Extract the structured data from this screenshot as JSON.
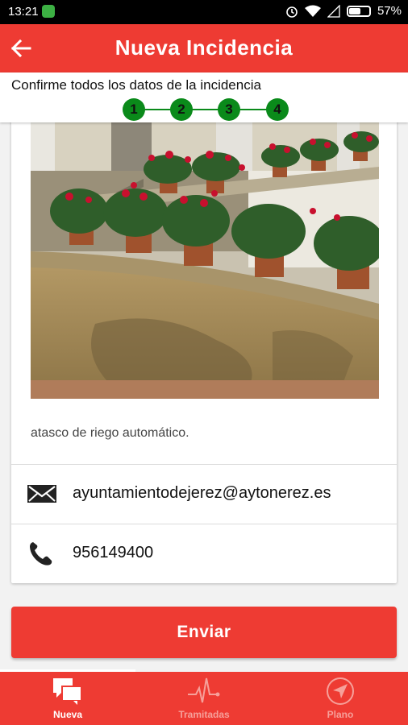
{
  "status_bar": {
    "time": "13:21",
    "battery": "57%",
    "battery_level": 0.57
  },
  "app_bar": {
    "title": "Nueva Incidencia"
  },
  "header": {
    "subtitle": "Confirme todos los datos de la incidencia",
    "steps": [
      "1",
      "2",
      "3",
      "4"
    ]
  },
  "incident": {
    "description": "atasco de riego automático.",
    "email": "ayuntamientodejerez@aytonerez.es",
    "phone": "956149400"
  },
  "actions": {
    "send_label": "Enviar"
  },
  "bottom_nav": {
    "items": [
      {
        "label": "Nueva",
        "icon": "chat-bubbles-icon",
        "active": true
      },
      {
        "label": "Tramitadas",
        "icon": "pulse-icon",
        "active": false
      },
      {
        "label": "Plano",
        "icon": "compass-icon",
        "active": false
      }
    ]
  },
  "colors": {
    "primary": "#ee3b33",
    "step_green": "#0a8a1a"
  }
}
